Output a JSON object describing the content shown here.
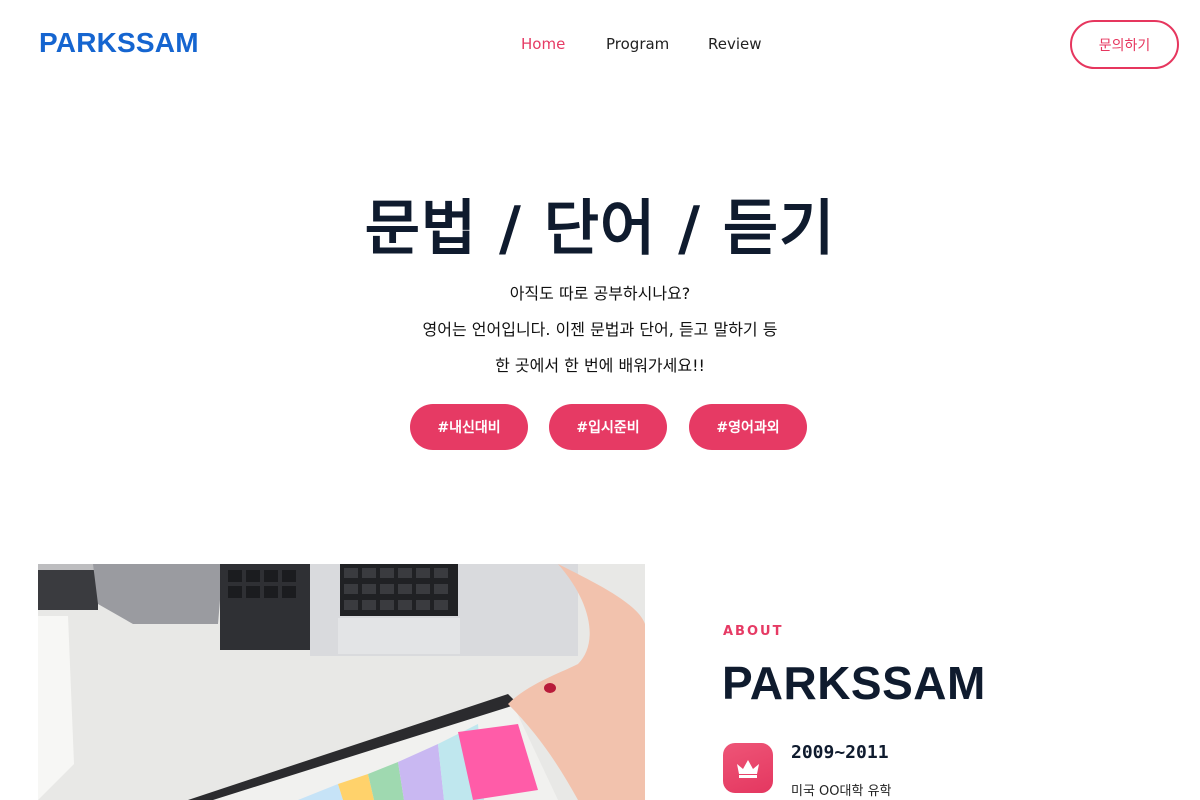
{
  "header": {
    "logo": "PARKSSAM",
    "nav": [
      {
        "label": "Home",
        "active": true
      },
      {
        "label": "Program",
        "active": false
      },
      {
        "label": "Review",
        "active": false
      }
    ],
    "contact_label": "문의하기"
  },
  "hero": {
    "title": "문법 / 단어 / 듣기",
    "lines": [
      "아직도 따로 공부하시나요?",
      "영어는 언어입니다. 이젠 문법과 단어, 듣고 말하기 등",
      "한 곳에서 한 번에 배워가세요!!"
    ],
    "tags": [
      "#내신대비",
      "#입시준비",
      "#영어과외"
    ]
  },
  "about": {
    "label": "ABOUT",
    "title": "PARKSSAM",
    "history": [
      {
        "icon": "crown-icon",
        "year": "2009~2011",
        "desc": "미국 OO대학 유학"
      }
    ]
  },
  "colors": {
    "brand_blue": "#1565d0",
    "accent": "#e63a64",
    "heading": "#0f1b2e"
  }
}
